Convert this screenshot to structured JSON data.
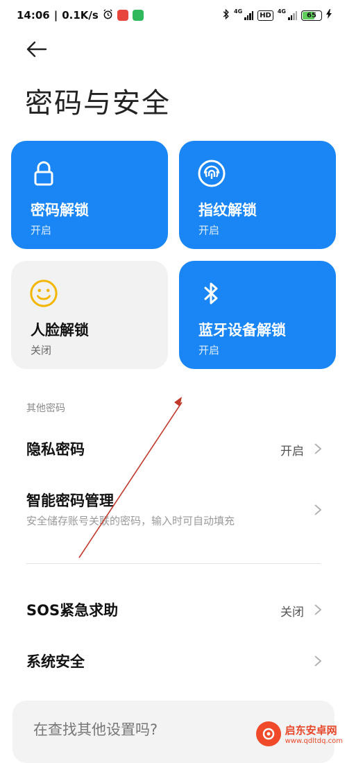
{
  "status_bar": {
    "time": "14:06",
    "speed": "0.1K/s",
    "net_label_1": "4G",
    "net_label_2": "4G",
    "hd": "HD",
    "battery": "65",
    "battery_level": 0.65
  },
  "header": {
    "title": "密码与安全"
  },
  "cards": [
    {
      "title": "密码解锁",
      "status": "开启",
      "icon": "lock-icon",
      "active": true
    },
    {
      "title": "指纹解锁",
      "status": "开启",
      "icon": "fingerprint-icon",
      "active": true
    },
    {
      "title": "人脸解锁",
      "status": "关闭",
      "icon": "smiley-face-icon",
      "active": false
    },
    {
      "title": "蓝牙设备解锁",
      "status": "开启",
      "icon": "bluetooth-icon",
      "active": true
    }
  ],
  "other_passwords": {
    "label": "其他密码",
    "items": [
      {
        "title": "隐私密码",
        "value": "开启"
      },
      {
        "title": "智能密码管理",
        "subtitle": "安全储存账号关联的密码，输入时可自动填充"
      }
    ]
  },
  "more": {
    "items": [
      {
        "title": "SOS紧急求助",
        "value": "关闭"
      },
      {
        "title": "系统安全"
      }
    ]
  },
  "search": {
    "placeholder": "在查找其他设置吗?"
  },
  "watermark": {
    "name": "启东安卓网",
    "url": "www.qdltdq.com"
  },
  "colors": {
    "accent": "#1a86f5",
    "card_grey": "#f2f2f2",
    "annotation_arrow": "#c0392b"
  }
}
